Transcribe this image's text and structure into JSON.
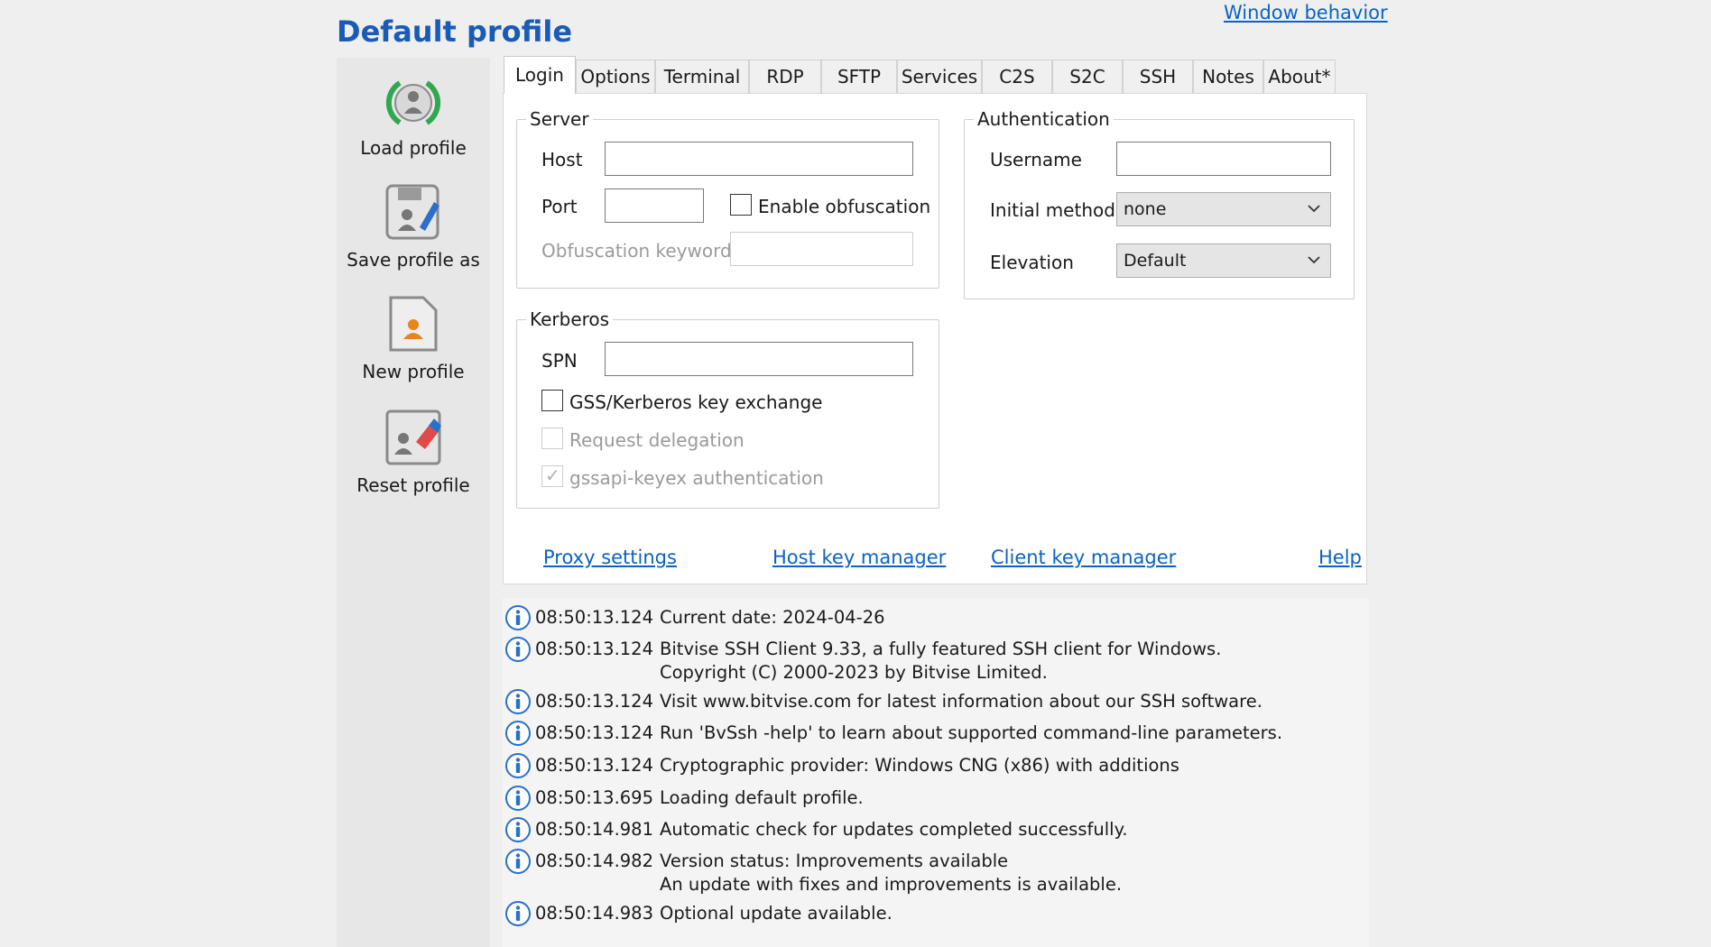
{
  "header": {
    "title": "Default profile",
    "window_behavior": "Window behavior"
  },
  "sidebar": {
    "items": [
      {
        "label": "Load profile",
        "icon": "load-profile-icon"
      },
      {
        "label": "Save profile as",
        "icon": "save-profile-icon"
      },
      {
        "label": "New profile",
        "icon": "new-profile-icon"
      },
      {
        "label": "Reset profile",
        "icon": "reset-profile-icon"
      }
    ]
  },
  "tabs": [
    "Login",
    "Options",
    "Terminal",
    "RDP",
    "SFTP",
    "Services",
    "C2S",
    "S2C",
    "SSH",
    "Notes",
    "About*"
  ],
  "active_tab": "Login",
  "server": {
    "legend": "Server",
    "host_label": "Host",
    "host_value": "",
    "port_label": "Port",
    "port_value": "",
    "obfuscation_label": "Enable obfuscation",
    "obfuscation_checked": false,
    "keyword_label": "Obfuscation keyword",
    "keyword_value": ""
  },
  "kerberos": {
    "legend": "Kerberos",
    "spn_label": "SPN",
    "spn_value": "",
    "gss_label": "GSS/Kerberos key exchange",
    "delegation_label": "Request delegation",
    "gssapi_label": "gssapi-keyex authentication"
  },
  "authentication": {
    "legend": "Authentication",
    "username_label": "Username",
    "username_value": "",
    "method_label": "Initial method",
    "method_value": "none",
    "elevation_label": "Elevation",
    "elevation_value": "Default"
  },
  "links": {
    "proxy": "Proxy settings",
    "hostkey": "Host key manager",
    "clientkey": "Client key manager",
    "help": "Help"
  },
  "log": [
    {
      "time": "08:50:13.124",
      "msg": "Current date: 2024-04-26"
    },
    {
      "time": "08:50:13.124",
      "msg": "Bitvise SSH Client 9.33, a fully featured SSH client for Windows.",
      "msg2": "Copyright (C) 2000-2023 by Bitvise Limited."
    },
    {
      "time": "08:50:13.124",
      "msg": "Visit www.bitvise.com for latest information about our SSH software."
    },
    {
      "time": "08:50:13.124",
      "msg": "Run 'BvSsh -help' to learn about supported command-line parameters."
    },
    {
      "time": "08:50:13.124",
      "msg": "Cryptographic provider: Windows CNG (x86) with additions"
    },
    {
      "time": "08:50:13.695",
      "msg": "Loading default profile."
    },
    {
      "time": "08:50:14.981",
      "msg": "Automatic check for updates completed successfully."
    },
    {
      "time": "08:50:14.982",
      "msg": "Version status: Improvements available",
      "msg2": "An update with fixes and improvements is available."
    },
    {
      "time": "08:50:14.983",
      "msg": "Optional update available."
    }
  ],
  "colors": {
    "title": "#1a5bb8",
    "link": "#0b62c4",
    "info_icon": "#2a70c8",
    "green": "#2fa84f",
    "orange": "#e8841a"
  }
}
